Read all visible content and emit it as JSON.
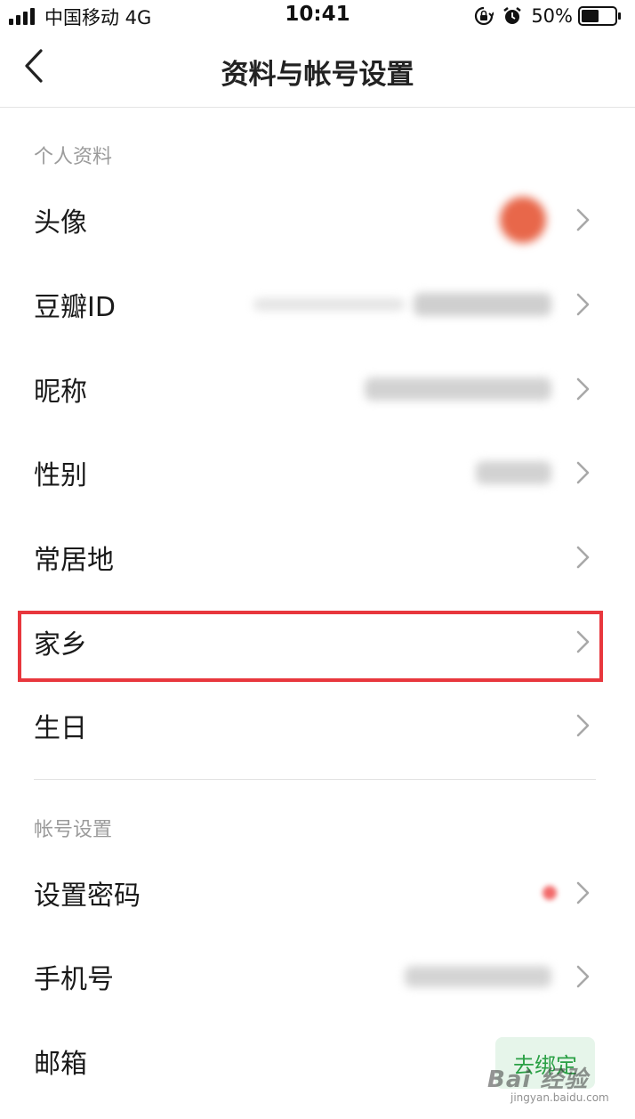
{
  "status_bar": {
    "carrier": "中国移动   4G",
    "time": "10:41",
    "battery": "50%"
  },
  "nav": {
    "title": "资料与帐号设置"
  },
  "sections": {
    "profile": {
      "title": "个人资料",
      "rows": {
        "avatar": "头像",
        "douban_id": "豆瓣ID",
        "nickname": "昵称",
        "gender": "性别",
        "residence": "常居地",
        "hometown": "家乡",
        "birthday": "生日"
      }
    },
    "account": {
      "title": "帐号设置",
      "rows": {
        "password": "设置密码",
        "phone": "手机号",
        "email": "邮箱"
      },
      "email_button": "去绑定"
    }
  },
  "watermark": {
    "text": "Bai 经验",
    "url": "jingyan.baidu.com"
  },
  "colors": {
    "highlight": "#e8373d",
    "accent_green": "#2aa045",
    "button_bg": "#e6f5ea"
  },
  "icons": [
    "back-chevron-icon",
    "chevron-right-icon",
    "signal-icon",
    "rotation-lock-icon",
    "alarm-icon",
    "battery-icon"
  ]
}
